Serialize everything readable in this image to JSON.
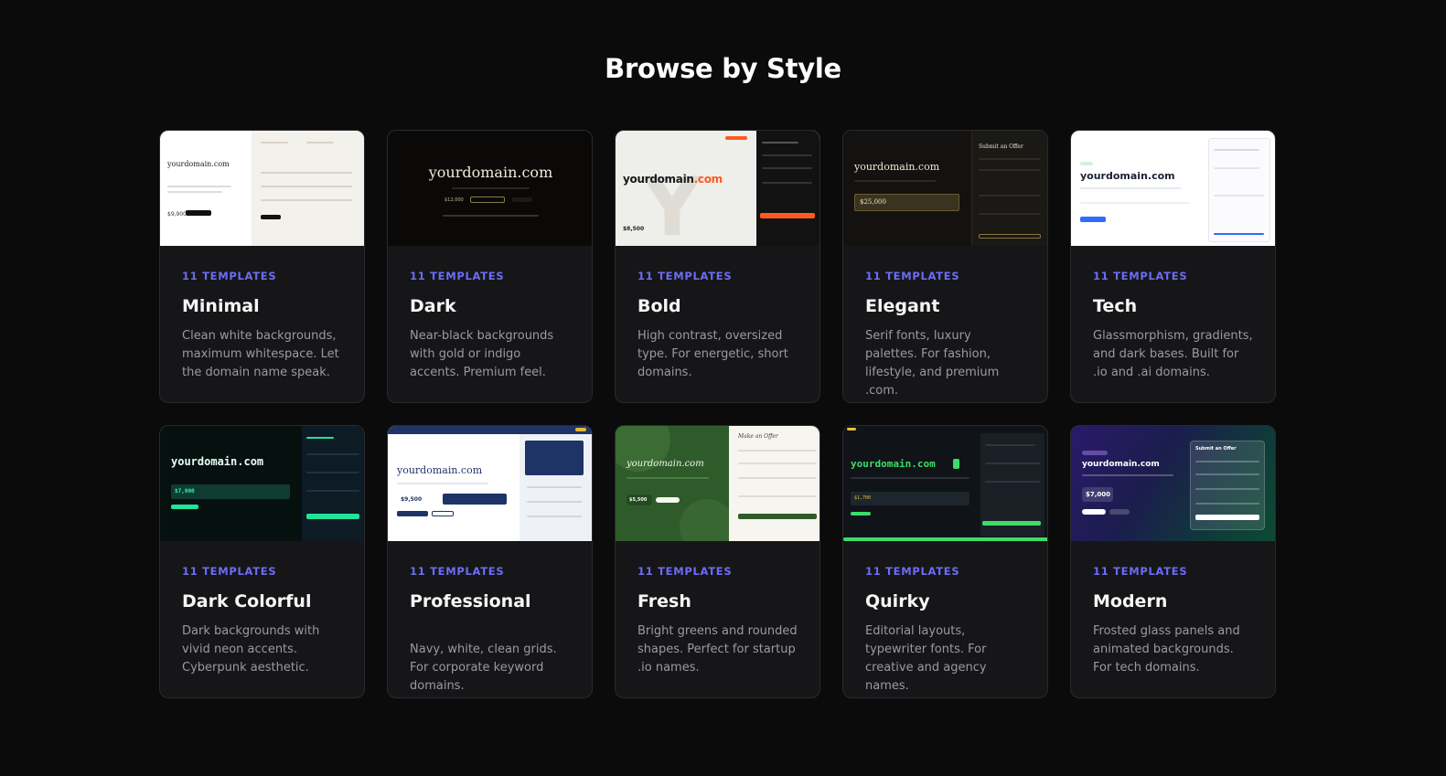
{
  "heading": "Browse by Style",
  "colors": {
    "background": "#0b0b0c",
    "card": "#161618",
    "accent": "#6c6cf5",
    "text_muted": "#9a9aa2"
  },
  "styles": [
    {
      "count": "11 TEMPLATES",
      "title": "Minimal",
      "description": "Clean white backgrounds, maximum whitespace. Let the domain name speak.",
      "preview": {
        "domain": "yourdomain.com",
        "price": "$9,900"
      }
    },
    {
      "count": "11 TEMPLATES",
      "title": "Dark",
      "description": "Near-black backgrounds with gold or indigo accents. Premium feel.",
      "preview": {
        "domain": "yourdomain.com",
        "price": "$12,000"
      }
    },
    {
      "count": "11 TEMPLATES",
      "title": "Bold",
      "description": "High contrast, oversized type. For energetic, short domains.",
      "preview": {
        "domain_part1": "yourdomain",
        "domain_part2": ".com",
        "price": "$8,500"
      }
    },
    {
      "count": "11 TEMPLATES",
      "title": "Elegant",
      "description": "Serif fonts, luxury palettes. For fashion, lifestyle, and premium .com.",
      "preview": {
        "domain": "yourdomain.com",
        "price": "$25,000",
        "panel_title": "Submit an Offer"
      }
    },
    {
      "count": "11 TEMPLATES",
      "title": "Tech",
      "description": "Glassmorphism, gradients, and dark bases. Built for .io and .ai domains.",
      "preview": {
        "domain": "yourdomain.com"
      }
    },
    {
      "count": "11 TEMPLATES",
      "title": "Dark Colorful",
      "description": "Dark backgrounds with vivid neon accents. Cyberpunk aesthetic.",
      "preview": {
        "domain": "yourdomain.com",
        "price": "$7,000"
      }
    },
    {
      "count": "11 TEMPLATES",
      "title": "Professional",
      "description": "Navy, white, clean grids. For corporate keyword domains.",
      "preview": {
        "domain": "yourdomain.com",
        "price": "$9,500"
      }
    },
    {
      "count": "11 TEMPLATES",
      "title": "Fresh",
      "description": "Bright greens and rounded shapes. Perfect for startup .io names.",
      "preview": {
        "domain": "yourdomain.com",
        "price": "$5,500",
        "panel_title": "Make an Offer"
      }
    },
    {
      "count": "11 TEMPLATES",
      "title": "Quirky",
      "description": "Editorial layouts, typewriter fonts. For creative and agency names.",
      "preview": {
        "domain": "yourdomain.com",
        "price": "$1,700"
      }
    },
    {
      "count": "11 TEMPLATES",
      "title": "Modern",
      "description": "Frosted glass panels and animated backgrounds. For tech domains.",
      "preview": {
        "domain": "yourdomain.com",
        "price": "$7,000",
        "panel_title": "Submit an Offer"
      }
    }
  ]
}
